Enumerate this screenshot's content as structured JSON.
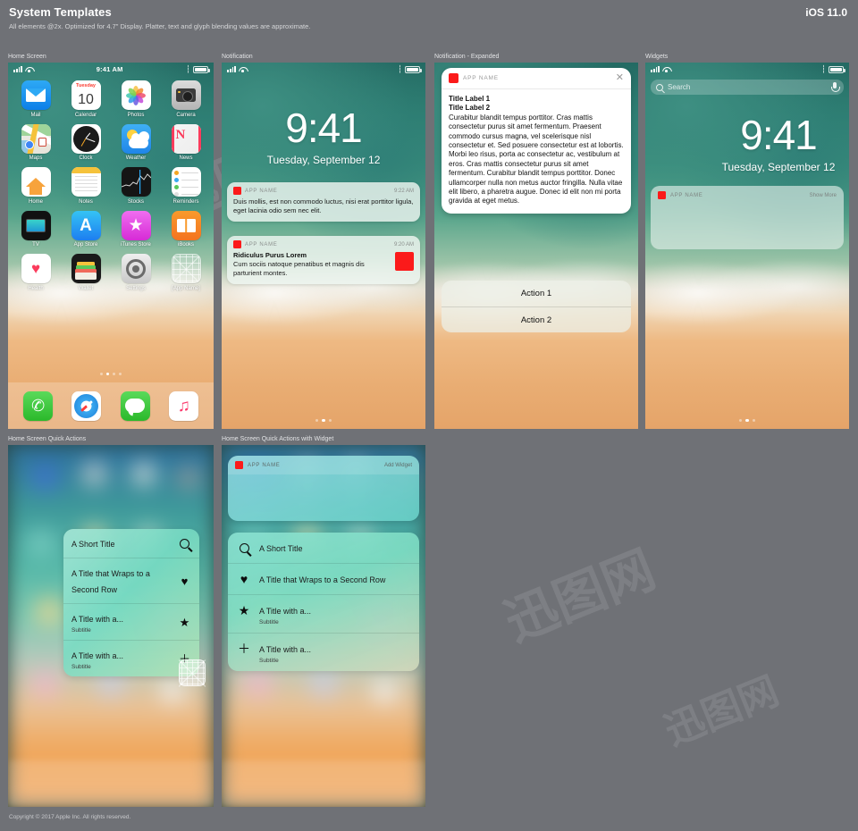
{
  "header": {
    "title": "System Templates",
    "subtitle": "All elements @2x. Optimized for 4.7\" Display. Platter, text and glyph blending values are approximate.",
    "version": "iOS 11.0"
  },
  "watermarks": [
    "迅图网",
    "迅图网",
    "迅图网"
  ],
  "panels": {
    "home_screen": "Home Screen",
    "notification": "Notification",
    "notification_expanded": "Notification - Expanded",
    "widgets": "Widgets",
    "quick_actions": "Home Screen Quick Actions",
    "quick_actions_widget": "Home Screen Quick Actions with Widget"
  },
  "status_bar": {
    "time": "9:41 AM"
  },
  "lock": {
    "time": "9:41",
    "date": "Tuesday, September 12"
  },
  "home": {
    "rows": [
      [
        {
          "label": "Mail",
          "icon": "mail-icon"
        },
        {
          "label": "Calendar",
          "icon": "calendar-icon",
          "day": "Tuesday",
          "date": "10"
        },
        {
          "label": "Photos",
          "icon": "photos-icon"
        },
        {
          "label": "Camera",
          "icon": "camera-icon"
        }
      ],
      [
        {
          "label": "Maps",
          "icon": "maps-icon"
        },
        {
          "label": "Clock",
          "icon": "clock-icon"
        },
        {
          "label": "Weather",
          "icon": "weather-icon"
        },
        {
          "label": "News",
          "icon": "news-icon",
          "glyph": "N"
        }
      ],
      [
        {
          "label": "Home",
          "icon": "home-icon"
        },
        {
          "label": "Notes",
          "icon": "notes-icon"
        },
        {
          "label": "Stocks",
          "icon": "stocks-icon"
        },
        {
          "label": "Reminders",
          "icon": "reminders-icon"
        }
      ],
      [
        {
          "label": "TV",
          "icon": "tv-icon"
        },
        {
          "label": "App Store",
          "icon": "app-store-icon",
          "glyph": "A"
        },
        {
          "label": "iTunes Store",
          "icon": "itunes-store-icon",
          "glyph": "★"
        },
        {
          "label": "iBooks",
          "icon": "ibooks-icon"
        }
      ],
      [
        {
          "label": "Health",
          "icon": "health-icon",
          "glyph": "♥"
        },
        {
          "label": "Wallet",
          "icon": "wallet-icon"
        },
        {
          "label": "Settings",
          "icon": "settings-icon"
        },
        {
          "label": "[App Name]",
          "icon": "app-placeholder-icon"
        }
      ]
    ],
    "dock": [
      {
        "label": "Phone",
        "icon": "phone-icon",
        "glyph": "✆"
      },
      {
        "label": "Safari",
        "icon": "safari-icon"
      },
      {
        "label": "Messages",
        "icon": "messages-icon"
      },
      {
        "label": "Music",
        "icon": "music-icon",
        "glyph": "♫"
      }
    ],
    "page_dots": {
      "count": 4,
      "active": 1
    }
  },
  "notifications": [
    {
      "app_name": "APP NAME",
      "time": "9:22 AM",
      "body": "Duis mollis, est non commodo luctus, nisi erat porttitor ligula, eget lacinia odio sem nec elit."
    },
    {
      "app_name": "APP NAME",
      "time": "9:20 AM",
      "title": "Ridiculus Purus Lorem",
      "body": "Cum sociis natoque penatibus et magnis dis parturient montes.",
      "has_thumb": true
    }
  ],
  "notification_page_dots": {
    "count": 3,
    "active": 1
  },
  "expanded": {
    "app_name": "APP NAME",
    "close_glyph": "✕",
    "title_1": "Title Label 1",
    "title_2": "Title Label 2",
    "body": "Curabitur blandit tempus porttitor. Cras mattis consectetur purus sit amet fermentum. Praesent commodo cursus magna, vel scelerisque nisl consectetur et. Sed posuere consectetur est at lobortis. Morbi leo risus, porta ac consectetur ac, vestibulum at eros. Cras mattis consectetur purus sit amet fermentum. Curabitur blandit tempus porttitor. Donec ullamcorper nulla non metus auctor fringilla. Nulla vitae elit libero, a pharetra augue. Donec id elit non mi porta gravida at eget metus.",
    "actions": [
      "Action 1",
      "Action 2"
    ]
  },
  "widgets": {
    "search_placeholder": "Search",
    "card": {
      "app_name": "APP NAME",
      "show_more": "Show More"
    },
    "page_dots": {
      "count": 3,
      "active": 1
    }
  },
  "quick_actions": {
    "items": [
      {
        "title": "A Short Title",
        "subtitle": "",
        "icon": "search-icon"
      },
      {
        "title": "A Title that Wraps to a Second Row",
        "subtitle": "",
        "icon": "heart-icon",
        "glyph": "♥"
      },
      {
        "title": "A Title with a...",
        "subtitle": "Subtitle",
        "icon": "star-icon",
        "glyph": "★"
      },
      {
        "title": "A Title with a...",
        "subtitle": "Subtitle",
        "icon": "plus-icon",
        "glyph": "＋"
      }
    ]
  },
  "quick_actions_widget": {
    "card": {
      "app_name": "APP NAME",
      "add_widget": "Add Widget"
    },
    "items": [
      {
        "title": "A Short Title",
        "subtitle": "",
        "icon": "search-icon"
      },
      {
        "title": "A Title that Wraps to a Second Row",
        "subtitle": "",
        "icon": "heart-icon",
        "glyph": "♥"
      },
      {
        "title": "A Title with a...",
        "subtitle": "Subtitle",
        "icon": "star-icon",
        "glyph": "★"
      },
      {
        "title": "A Title with a...",
        "subtitle": "Subtitle",
        "icon": "plus-icon",
        "glyph": "＋"
      }
    ]
  },
  "footer": {
    "copyright": "Copyright © 2017 Apple Inc. All rights reserved."
  },
  "colors": {
    "badge_red": "#fb1a1a",
    "bg": "#6f7176"
  }
}
